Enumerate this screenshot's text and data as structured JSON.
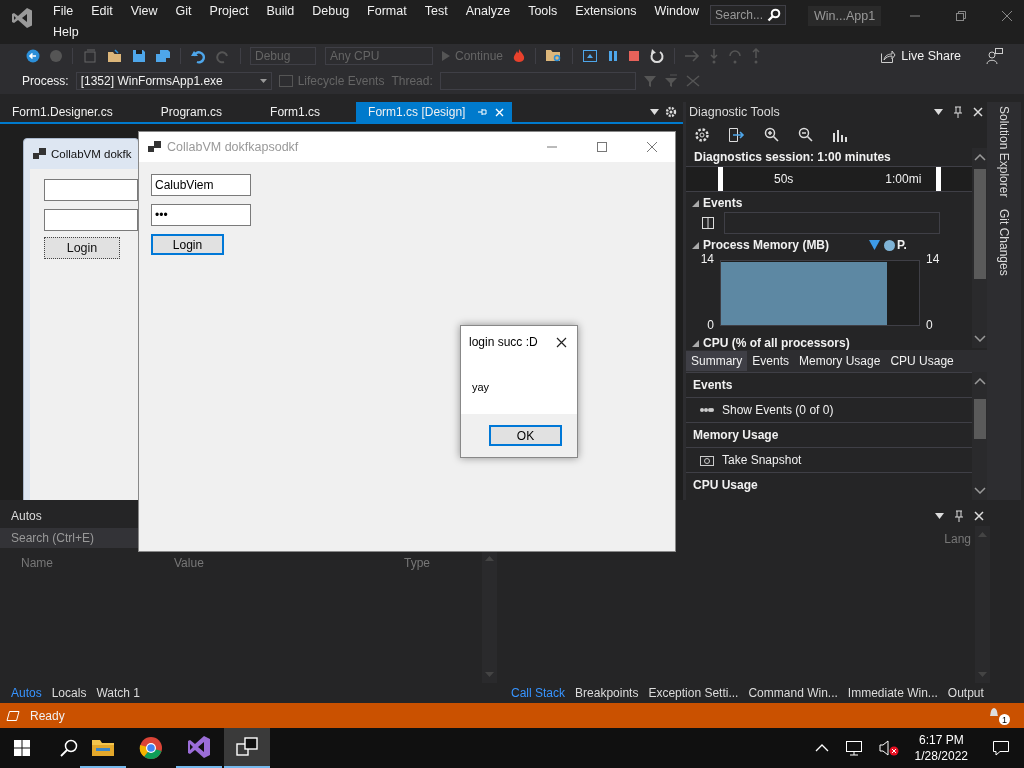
{
  "menu_rows": [
    [
      "File",
      "Edit",
      "View",
      "Git",
      "Project",
      "Build",
      "Debug",
      "Format",
      "Test",
      "Analyze",
      "Tools",
      "Extensions",
      "Window"
    ],
    [
      "Help"
    ]
  ],
  "search": {
    "placeholder": "Search..."
  },
  "window": {
    "title": "Win...App1"
  },
  "toolbar": {
    "configuration": {
      "value": "Debug",
      "disabled": true
    },
    "platform": {
      "value": "Any CPU",
      "disabled": true
    },
    "continue": {
      "label": "Continue",
      "disabled": true
    },
    "live_share": "Live Share",
    "process_label": "Process:",
    "process": "[1352] WinFormsApp1.exe",
    "lifecycle": {
      "label": "Lifecycle Events",
      "disabled": true
    },
    "thread": {
      "label": "Thread:",
      "disabled": true
    }
  },
  "doc_tabs": [
    {
      "label": "Form1.Designer.cs",
      "selected": false
    },
    {
      "label": "Program.cs",
      "selected": false
    },
    {
      "label": "Form1.cs",
      "selected": false
    },
    {
      "label": "Form1.cs [Design]",
      "selected": true
    }
  ],
  "designer": {
    "form_title": "CollabVM dokfk",
    "button": "Login"
  },
  "diagnostic_tools": {
    "title": "Diagnostic Tools",
    "session": "Diagnostics session: 1:00 minutes",
    "ruler": [
      "50s",
      "1:00mi"
    ],
    "events_heading": "Events",
    "memory": {
      "heading": "Process Memory (MB)",
      "legend": "P.",
      "left_axis": [
        "14",
        "0"
      ],
      "right_axis": [
        "14",
        "0"
      ]
    },
    "cpu_heading": "CPU (% of all processors)",
    "tabs": [
      {
        "label": "Summary",
        "selected": true
      },
      {
        "label": "Events",
        "selected": false
      },
      {
        "label": "Memory Usage",
        "selected": false
      },
      {
        "label": "CPU Usage",
        "selected": false
      }
    ],
    "sections": [
      {
        "heading": "Events",
        "action": {
          "kind": "events",
          "label": "Show Events (0 of 0)"
        }
      },
      {
        "heading": "Memory Usage",
        "action": {
          "kind": "snapshot",
          "label": "Take Snapshot"
        }
      },
      {
        "heading": "CPU Usage"
      }
    ]
  },
  "side_tabs": [
    "Solution Explorer",
    "Git Changes"
  ],
  "autos": {
    "title": "Autos",
    "search": {
      "placeholder": "Search (Ctrl+E)"
    },
    "columns": [
      "Name",
      "Value",
      "Type"
    ],
    "tabs": [
      {
        "label": "Autos",
        "selected": true
      },
      {
        "label": "Locals",
        "selected": false
      },
      {
        "label": "Watch 1",
        "selected": false
      }
    ]
  },
  "output_panel": {
    "column_1": "Lang",
    "tabs": [
      {
        "label": "Call Stack",
        "selected": true
      },
      {
        "label": "Breakpoints",
        "selected": false
      },
      {
        "label": "Exception Setti...",
        "selected": false
      },
      {
        "label": "Command Win...",
        "selected": false
      },
      {
        "label": "Immediate Win...",
        "selected": false
      },
      {
        "label": "Output",
        "selected": false
      }
    ]
  },
  "status_bar": {
    "text": "Ready",
    "notifications": "1"
  },
  "app_window": {
    "title": "CollabVM dokfkapsodkf",
    "username": "CalubViem",
    "password": "•••",
    "button": "Login"
  },
  "message_box": {
    "title": "login succ :D",
    "message": "yay",
    "button": "OK"
  },
  "taskbar": {
    "apps": [
      {
        "kind": "folder",
        "running": true,
        "selected": false
      },
      {
        "kind": "browser",
        "running": false,
        "selected": false
      },
      {
        "kind": "logo",
        "running": true,
        "selected": false
      },
      {
        "kind": "app",
        "running": true,
        "selected": true
      }
    ],
    "time": "6:17 PM",
    "date": "1/28/2022"
  }
}
